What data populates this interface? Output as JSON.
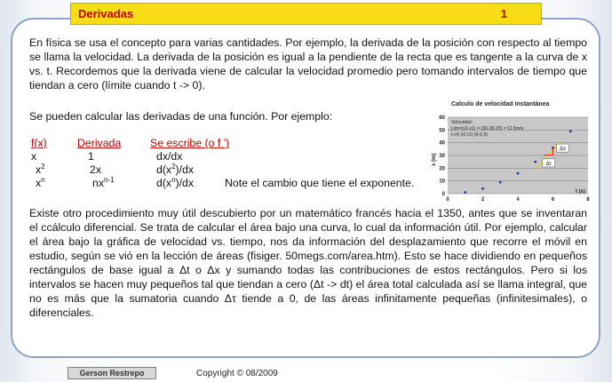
{
  "header": {
    "title": "Derivadas",
    "page_number": "1"
  },
  "paragraphs": {
    "p1": "En física se usa el concepto para varias cantidades. Por ejemplo, la derivada de la posición con respecto al tiempo se llama la velocidad. La derivada de la posición es igual a la pendiente de la recta que es tangente a la curva de x vs. t. Recordemos que la derivada viene de calcular la velocidad promedio pero tomando intervalos de tiempo que tiendan a cero (límite cuando t -> 0).",
    "p2": "Se pueden calcular las derivadas de una función. Por ejemplo:",
    "p3": "Existe otro procedimiento muy útil descubierto por un matemático francés hacia el 1350, antes que se inventaran el ccálculo diferencial. Se trata de calcular el área bajo una curva, lo cual da información útil. Por ejemplo, calcular el área bajo la gráfica de velocidad vs. tiempo, nos da información del desplazamiento que recorre el móvil en estudio, según se vió en la lección de áreas (fisiger. 50megs.com/area.htm). Esto se hace dividiendo en pequeños rectángulos de base igual a Δt o Δx y sumando todas las contribuciones de estos rectángulos. Pero si los intervalos se hacen muy pequeños tal que tiendan a cero (Δt -> dt) el área total calculada así se llama integral, que no es más que la sumatoria cuando Δτ tiende a 0, de las áreas infinitamente pequeñas (infinitesimales), o diferenciales."
  },
  "table": {
    "headers": [
      "f(x)",
      "Derivada",
      "Se escribe (o f ')"
    ],
    "rows": [
      {
        "fx": "x",
        "fx_sup": "",
        "der": "1",
        "der_sup": "",
        "w1": "dx/dx",
        "w1_sup": "",
        "w2": "",
        "note": ""
      },
      {
        "fx": "x",
        "fx_sup": "2",
        "der": "2x",
        "der_sup": "",
        "w1": "d(x",
        "w1_sup": "2",
        "w2": ")/dx",
        "note": ""
      },
      {
        "fx": "x",
        "fx_sup": "n",
        "der": "nx",
        "der_sup": "n-1",
        "w1": "d(x",
        "w1_sup": "n",
        "w2": ")/dx",
        "note": "Note el cambio que tiene el exponente."
      }
    ]
  },
  "chart_data": {
    "type": "scatter",
    "title": "Calculo de velocidad instantánea",
    "ylabel": "x (m)",
    "xlabel": "t (s)",
    "xlim": [
      0,
      8
    ],
    "ylim": [
      0,
      60
    ],
    "x_ticks": [
      "0",
      "2",
      "4",
      "6",
      "8"
    ],
    "y_ticks": [
      "0",
      "10",
      "20",
      "30",
      "40",
      "50",
      "60"
    ],
    "series": [
      {
        "x": [
          1,
          2,
          3,
          4,
          5,
          6,
          7
        ],
        "y": [
          1,
          4,
          9,
          16,
          25,
          36,
          49
        ]
      }
    ],
    "annotation_lines": [
      "Velocidad:",
      "Lim=(x2-x1) = (36-30.25) = 11.5m/s",
      "t->0 (t2-t1)       (6-5.5)"
    ],
    "delta_x_label": "Δx",
    "delta_t_label": "Δt",
    "colors": {
      "plot_bg": "#c8c8c8",
      "point": "#1f3c9a",
      "tangent": "#d8d800",
      "delta": "#d00000"
    },
    "grid": true
  },
  "footer": {
    "author": "Gerson Restrepo",
    "copyright": "Copyright ©   08/2009"
  },
  "colors": {
    "accent": "#f7dc16",
    "title_text": "#c00000",
    "frame": "#8fa4c4"
  }
}
